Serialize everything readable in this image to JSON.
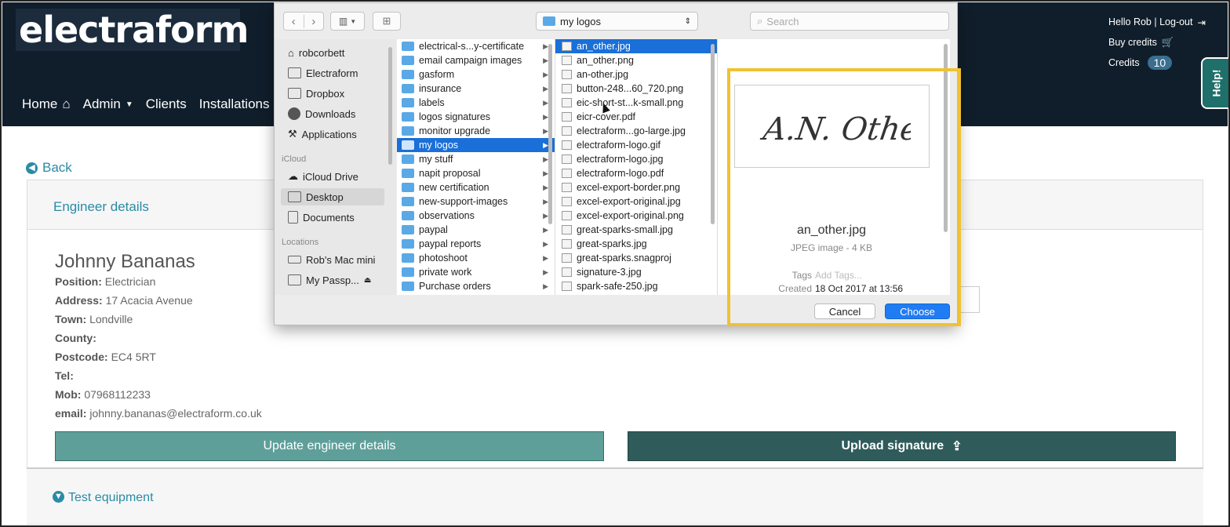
{
  "brand": "electraform",
  "header": {
    "greeting": "Hello Rob | Log-out",
    "buy_credits": "Buy credits",
    "credits_label": "Credits",
    "credits_count": "10",
    "help_label": "Help!"
  },
  "nav": {
    "home": "Home",
    "admin": "Admin",
    "clients": "Clients",
    "installations": "Installations"
  },
  "page": {
    "back_label": "Back",
    "section_title": "Engineer details",
    "engineer_name": "Johnny Bananas",
    "fields": [
      {
        "label": "Position:",
        "value": "Electrician"
      },
      {
        "label": "Address:",
        "value": "17 Acacia Avenue"
      },
      {
        "label": "Town:",
        "value": "Londville"
      },
      {
        "label": "County:",
        "value": ""
      },
      {
        "label": "Postcode:",
        "value": "EC4 5RT"
      },
      {
        "label": "Tel:",
        "value": ""
      },
      {
        "label": "Mob:",
        "value": "07968112233"
      },
      {
        "label": "email:",
        "value": "johnny.bananas@electraform.co.uk"
      }
    ],
    "update_button": "Update engineer details",
    "upload_button": "Upload signature",
    "test_equipment": "Test equipment"
  },
  "dialog": {
    "path_folder": "my logos",
    "search_placeholder": "Search",
    "sidebar": {
      "favorites": [
        "robcorbett",
        "Electraform",
        "Dropbox",
        "Downloads",
        "Applications"
      ],
      "icloud_heading": "iCloud",
      "icloud": [
        "iCloud Drive",
        "Desktop",
        "Documents"
      ],
      "locations_heading": "Locations",
      "locations": [
        "Rob's Mac mini",
        "My Passp..."
      ]
    },
    "folders": [
      "electrical-s...y-certificate",
      "email campaign images",
      "gasform",
      "insurance",
      "labels",
      "logos signatures",
      "monitor upgrade",
      "my logos",
      "my stuff",
      "napit proposal",
      "new certification",
      "new-support-images",
      "observations",
      "paypal",
      "paypal reports",
      "photoshoot",
      "private work",
      "Purchase orders"
    ],
    "selected_folder": "my logos",
    "files": [
      "an_other.jpg",
      "an_other.png",
      "an-other.jpg",
      "button-248...60_720.png",
      "eic-short-st...k-small.png",
      "eicr-cover.pdf",
      "electraform...go-large.jpg",
      "electraform-logo.gif",
      "electraform-logo.jpg",
      "electraform-logo.pdf",
      "excel-export-border.png",
      "excel-export-original.jpg",
      "excel-export-original.png",
      "great-sparks-small.jpg",
      "great-sparks.jpg",
      "great-sparks.snagproj",
      "signature-3.jpg",
      "spark-safe-250.jpg"
    ],
    "selected_file": "an_other.jpg",
    "preview": {
      "signature_text": "A.N. Other.",
      "name": "an_other.jpg",
      "kind": "JPEG image - 4 KB",
      "tags_label": "Tags",
      "tags_placeholder": "Add Tags...",
      "created_label": "Created",
      "created_value": "18 Oct 2017 at 13:56"
    },
    "cancel": "Cancel",
    "choose": "Choose"
  },
  "colors": {
    "navbar": "#101e2b",
    "accent": "#2a8ba6",
    "highlight": "#f0c231",
    "dialog_primary": "#1f7cf2"
  }
}
